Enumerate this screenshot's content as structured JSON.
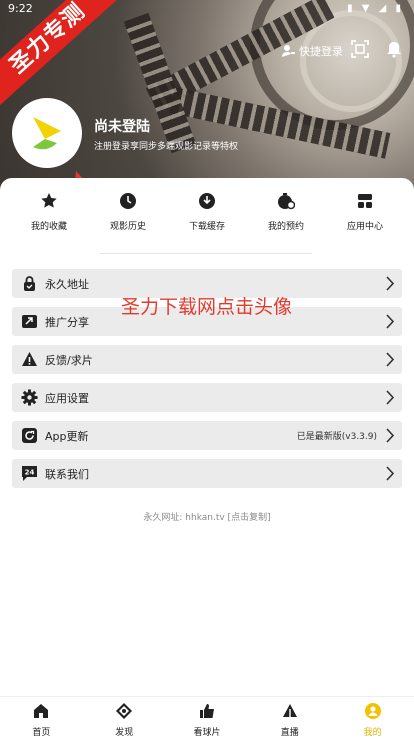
{
  "status": {
    "time": "9:22"
  },
  "banner": {
    "text": "圣力专测"
  },
  "header": {
    "quick_login": "快捷登录"
  },
  "user": {
    "name": "尚未登陆",
    "subtitle": "注册登录享同步多端观影记录等特权"
  },
  "shortcuts": [
    {
      "label": "我的收藏",
      "icon": "star-icon"
    },
    {
      "label": "观影历史",
      "icon": "clock-icon"
    },
    {
      "label": "下载缓存",
      "icon": "download-icon"
    },
    {
      "label": "我的预约",
      "icon": "reservation-icon"
    },
    {
      "label": "应用中心",
      "icon": "app-center-icon"
    }
  ],
  "menu": [
    {
      "label": "永久地址",
      "icon": "lock-icon"
    },
    {
      "label": "推广分享",
      "icon": "share-icon"
    },
    {
      "label": "反馈/求片",
      "icon": "warning-icon"
    },
    {
      "label": "应用设置",
      "icon": "gear-icon"
    },
    {
      "label": "App更新",
      "icon": "refresh-icon",
      "right": "已是最新版(v3.3.9)"
    },
    {
      "label": "联系我们",
      "icon": "contact-24-icon"
    }
  ],
  "footer_url": "永久网址: hhkan.tv [点击复制]",
  "annotation": {
    "text": "圣力下载网点击头像",
    "color": "#e23a2c"
  },
  "tabs": [
    {
      "label": "首页",
      "icon": "home-icon"
    },
    {
      "label": "发现",
      "icon": "discover-icon"
    },
    {
      "label": "看球片",
      "icon": "thumb-icon"
    },
    {
      "label": "直播",
      "icon": "live-icon"
    },
    {
      "label": "我的",
      "icon": "profile-icon",
      "active": true
    }
  ],
  "colors": {
    "accent": "#f2c200",
    "annotation": "#e23a2c",
    "banner": "#e0231c"
  }
}
